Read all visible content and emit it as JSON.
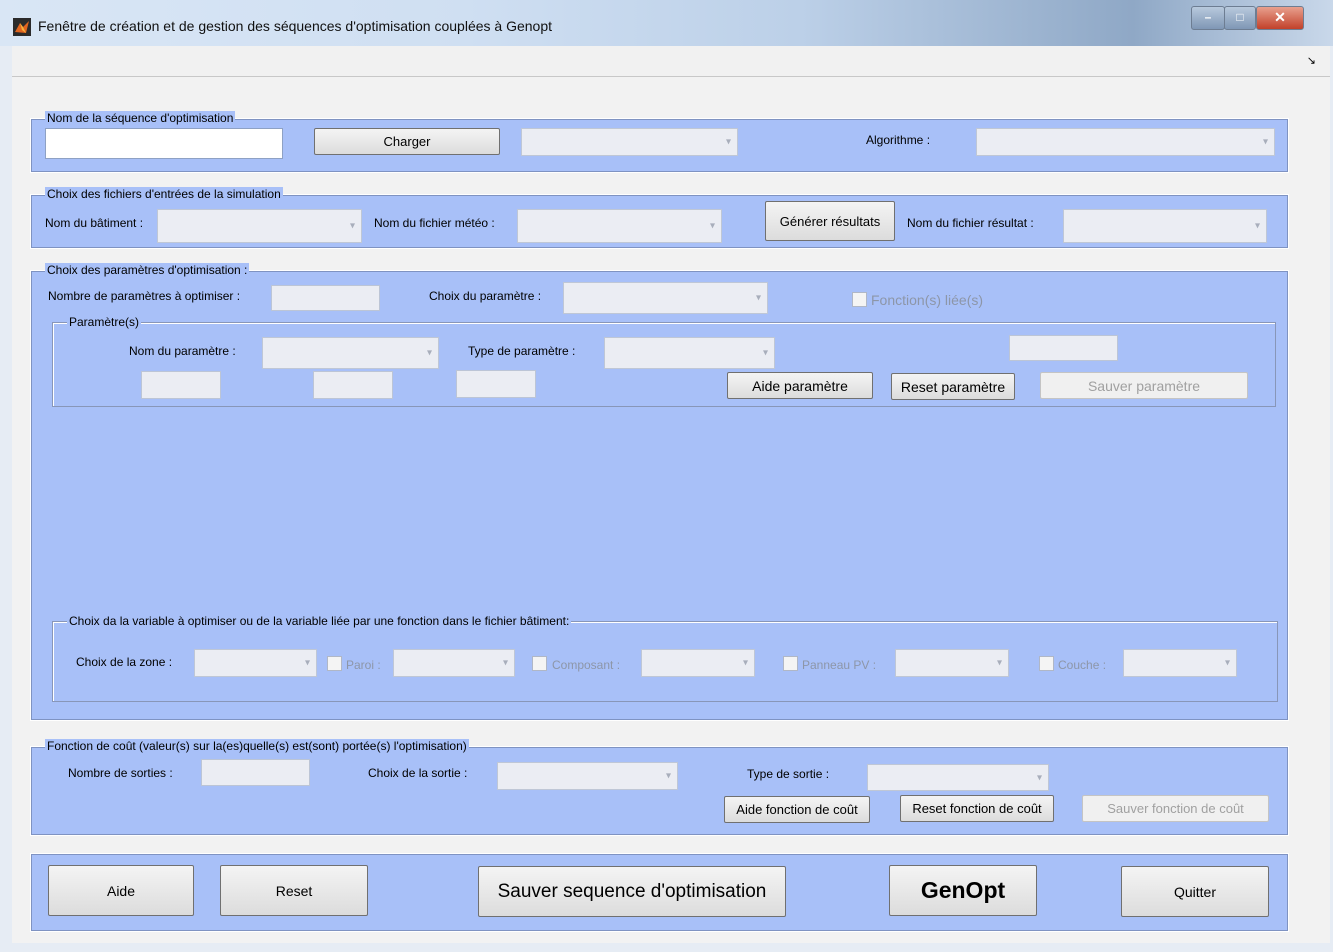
{
  "window": {
    "title": "Fenêtre de création et de gestion des séquences d'optimisation couplées à Genopt"
  },
  "controls": {
    "minimize": "–",
    "maximize": "□",
    "close": "✕",
    "corner": "↘"
  },
  "seq": {
    "legend": "Nom de la séquence d'optimisation",
    "name_value": "",
    "load_button": "Charger",
    "algorithm_label": "Algorithme :"
  },
  "files": {
    "legend": "Choix des fichiers d'entrées de la simulation",
    "building_label": "Nom du bâtiment :",
    "weather_label": "Nom du fichier météo :",
    "generate_button": "Générer résultats",
    "result_label": "Nom du fichier résultat :"
  },
  "params": {
    "legend": "Choix des paramètres d'optimisation :",
    "count_label": "Nombre de paramètres à optimiser :",
    "choice_label": "Choix du paramètre :",
    "linked_label": "Fonction(s) liée(s)",
    "sub_legend": "Paramètre(s)",
    "name_label": "Nom du paramètre :",
    "type_label": "Type de paramètre :",
    "help_button": "Aide paramètre",
    "reset_button": "Reset paramètre",
    "save_button": "Sauver paramètre",
    "var_legend": "Choix da la variable à optimiser ou de la variable liée par une fonction dans le fichier bâtiment:",
    "zone_label": "Choix de la zone :",
    "paroi_label": "Paroi :",
    "composant_label": "Composant :",
    "pv_label": "Panneau PV :",
    "couche_label": "Couche :"
  },
  "cost": {
    "legend": "Fonction de coût (valeur(s) sur la(es)quelle(s) est(sont) portée(s) l'optimisation)",
    "outputs_label": "Nombre de sorties :",
    "output_choice_label": "Choix de la sortie :",
    "output_type_label": "Type de sortie :",
    "help_button": "Aide fonction de coût",
    "reset_button": "Reset fonction de coût",
    "save_button": "Sauver fonction de coût"
  },
  "footer": {
    "help": "Aide",
    "reset": "Reset",
    "save_sequence": "Sauver sequence d'optimisation",
    "genopt": "GenOpt",
    "quit": "Quitter"
  }
}
